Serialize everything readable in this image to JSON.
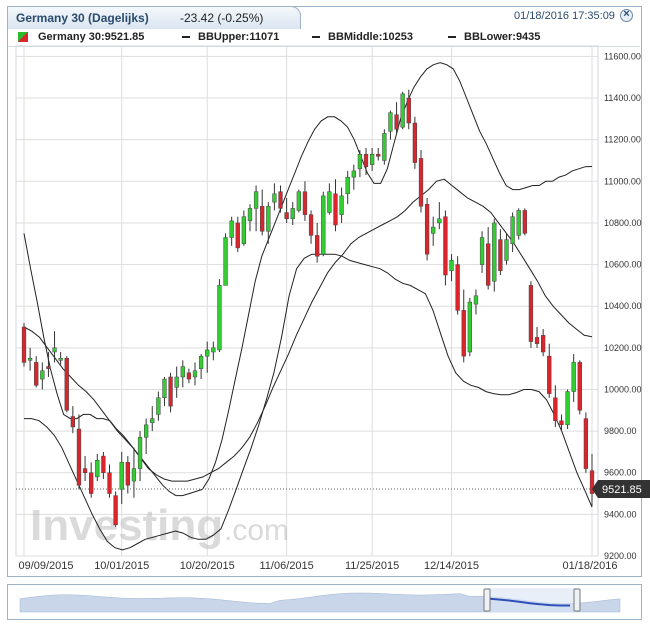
{
  "header": {
    "title": "Germany 30 (Dagelijks)",
    "change": "-23.42 (-0.25%)",
    "datetime": "01/18/2016 17:35:09"
  },
  "legend": {
    "instrument": "Germany 30:9521.85",
    "bb_upper": "BBUpper:11071",
    "bb_middle": "BBMiddle:10253",
    "bb_lower": "BBLower:9435"
  },
  "watermark": "Investing.com",
  "colors": {
    "up": "#33cc33",
    "down": "#d9252b",
    "band": "#222222",
    "grid": "#dddddd",
    "price_tag": "#333333"
  },
  "chart_data": {
    "type": "candlestick",
    "title": "Germany 30 (Dagelijks)",
    "ylim": [
      9200,
      11650
    ],
    "y_ticks": [
      "9200.00",
      "9400.00",
      "9600.00",
      "9800.00",
      "10000.00",
      "10200.00",
      "10400.00",
      "10600.00",
      "10800.00",
      "11000.00",
      "11200.00",
      "11400.00",
      "11600.00"
    ],
    "y_tick_values": [
      9200,
      9400,
      9600,
      9800,
      10000,
      10200,
      10400,
      10600,
      10800,
      11000,
      11200,
      11400,
      11600
    ],
    "x_labels": [
      "09/09/2015",
      "10/01/2015",
      "10/20/2015",
      "11/06/2015",
      "11/25/2015",
      "12/14/2015",
      "01/18/2016"
    ],
    "x_label_index": [
      0,
      16,
      30,
      43,
      57,
      70,
      93
    ],
    "last_price": "9521.85",
    "last_value": 9521.85,
    "candles": [
      [
        10300,
        10320,
        10110,
        10130
      ],
      [
        10140,
        10200,
        10090,
        10150
      ],
      [
        10130,
        10160,
        10010,
        10020
      ],
      [
        10050,
        10130,
        10000,
        10090
      ],
      [
        10110,
        10180,
        10060,
        10100
      ],
      [
        10180,
        10280,
        10130,
        10200
      ],
      [
        10140,
        10180,
        10120,
        10150
      ],
      [
        10150,
        10160,
        9890,
        9900
      ],
      [
        9870,
        9920,
        9790,
        9820
      ],
      [
        9810,
        9880,
        9520,
        9540
      ],
      [
        9620,
        9680,
        9560,
        9600
      ],
      [
        9600,
        9650,
        9480,
        9500
      ],
      [
        9580,
        9690,
        9560,
        9660
      ],
      [
        9680,
        9700,
        9570,
        9600
      ],
      [
        9600,
        9640,
        9480,
        9500
      ],
      [
        9490,
        9510,
        9340,
        9350
      ],
      [
        9520,
        9700,
        9450,
        9650
      ],
      [
        9650,
        9680,
        9500,
        9540
      ],
      [
        9560,
        9720,
        9480,
        9620
      ],
      [
        9620,
        9800,
        9560,
        9770
      ],
      [
        9770,
        9860,
        9690,
        9830
      ],
      [
        9840,
        9920,
        9800,
        9860
      ],
      [
        9880,
        9990,
        9850,
        9960
      ],
      [
        9960,
        10060,
        9920,
        10050
      ],
      [
        10060,
        10080,
        9890,
        9920
      ],
      [
        10010,
        10110,
        9960,
        10060
      ],
      [
        10060,
        10140,
        10010,
        10110
      ],
      [
        10080,
        10100,
        10030,
        10050
      ],
      [
        10060,
        10130,
        10020,
        10090
      ],
      [
        10100,
        10170,
        10050,
        10160
      ],
      [
        10160,
        10230,
        10080,
        10190
      ],
      [
        10180,
        10230,
        10140,
        10200
      ],
      [
        10190,
        10530,
        10180,
        10500
      ],
      [
        10500,
        10750,
        10500,
        10730
      ],
      [
        10730,
        10830,
        10690,
        10810
      ],
      [
        10800,
        10830,
        10660,
        10680
      ],
      [
        10700,
        10860,
        10690,
        10830
      ],
      [
        10810,
        10890,
        10760,
        10870
      ],
      [
        10870,
        10980,
        10760,
        10950
      ],
      [
        10880,
        10960,
        10740,
        10760
      ],
      [
        10760,
        10900,
        10700,
        10880
      ],
      [
        10900,
        10990,
        10860,
        10940
      ],
      [
        10950,
        10980,
        10850,
        10870
      ],
      [
        10850,
        10920,
        10800,
        10820
      ],
      [
        10820,
        10900,
        10790,
        10870
      ],
      [
        10860,
        10960,
        10850,
        10950
      ],
      [
        10950,
        11000,
        10810,
        10840
      ],
      [
        10840,
        10860,
        10700,
        10740
      ],
      [
        10740,
        10800,
        10610,
        10640
      ],
      [
        10650,
        10950,
        10640,
        10930
      ],
      [
        10850,
        10990,
        10840,
        10950
      ],
      [
        10940,
        11010,
        10760,
        10790
      ],
      [
        10840,
        10970,
        10800,
        10930
      ],
      [
        10940,
        11050,
        10890,
        11020
      ],
      [
        11020,
        11080,
        10960,
        11050
      ],
      [
        11060,
        11150,
        11020,
        11130
      ],
      [
        11130,
        11160,
        11030,
        11070
      ],
      [
        11080,
        11160,
        11050,
        11130
      ],
      [
        11130,
        11160,
        11100,
        11120
      ],
      [
        11100,
        11250,
        11080,
        11230
      ],
      [
        11240,
        11340,
        11200,
        11330
      ],
      [
        11320,
        11380,
        11230,
        11250
      ],
      [
        11260,
        11430,
        11250,
        11420
      ],
      [
        11400,
        11440,
        11250,
        11280
      ],
      [
        11280,
        11310,
        11060,
        11090
      ],
      [
        11110,
        11150,
        10850,
        10880
      ],
      [
        10890,
        10920,
        10620,
        10650
      ],
      [
        10750,
        10830,
        10690,
        10780
      ],
      [
        10800,
        10900,
        10770,
        10820
      ],
      [
        10830,
        10860,
        10500,
        10550
      ],
      [
        10570,
        10650,
        10520,
        10620
      ],
      [
        10600,
        10640,
        10360,
        10380
      ],
      [
        10380,
        10480,
        10130,
        10160
      ],
      [
        10180,
        10440,
        10160,
        10420
      ],
      [
        10410,
        10480,
        10360,
        10450
      ],
      [
        10600,
        10760,
        10560,
        10730
      ],
      [
        10700,
        10780,
        10480,
        10500
      ],
      [
        10520,
        10820,
        10470,
        10800
      ],
      [
        10720,
        10770,
        10550,
        10570
      ],
      [
        10620,
        10750,
        10600,
        10720
      ],
      [
        10700,
        10850,
        10660,
        10830
      ],
      [
        10740,
        10870,
        10720,
        10860
      ],
      [
        10860,
        10870,
        10740,
        10750
      ],
      [
        10500,
        10520,
        10200,
        10230
      ],
      [
        10250,
        10300,
        10200,
        10220
      ],
      [
        10260,
        10290,
        10160,
        10180
      ],
      [
        10160,
        10220,
        9960,
        9980
      ],
      [
        9960,
        10020,
        9820,
        9850
      ],
      [
        9850,
        9880,
        9800,
        9830
      ],
      [
        9830,
        10000,
        9810,
        9990
      ],
      [
        9990,
        10170,
        9940,
        10130
      ],
      [
        10130,
        10140,
        9880,
        9900
      ],
      [
        9860,
        9890,
        9600,
        9620
      ],
      [
        9610,
        9690,
        9440,
        9500
      ]
    ],
    "bb_upper": [
      10750,
      10580,
      10420,
      10250,
      10100,
      9980,
      9880,
      9860,
      9860,
      9880,
      9880,
      9860,
      9860,
      9850,
      9810,
      9780,
      9740,
      9700,
      9660,
      9620,
      9580,
      9540,
      9510,
      9490,
      9490,
      9500,
      9510,
      9520,
      9570,
      9650,
      9760,
      9900,
      10050,
      10200,
      10360,
      10520,
      10640,
      10720,
      10800,
      10880,
      10960,
      11040,
      11120,
      11190,
      11250,
      11290,
      11310,
      11310,
      11290,
      11260,
      11200,
      11120,
      11040,
      10990,
      10990,
      11060,
      11180,
      11300,
      11380,
      11450,
      11500,
      11540,
      11560,
      11570,
      11560,
      11540,
      11480,
      11400,
      11320,
      11240,
      11180,
      11110,
      11040,
      10980,
      10960,
      10960,
      10970,
      10980,
      10980,
      11000,
      11000,
      11020,
      11030,
      11050,
      11060,
      11070,
      11071
    ],
    "bb_middle": [
      10300,
      10280,
      10250,
      10200,
      10150,
      10100,
      10060,
      10020,
      9990,
      9950,
      9900,
      9850,
      9800,
      9760,
      9720,
      9670,
      9620,
      9590,
      9570,
      9560,
      9560,
      9560,
      9570,
      9580,
      9600,
      9620,
      9650,
      9680,
      9720,
      9770,
      9840,
      9920,
      10010,
      10090,
      10170,
      10260,
      10340,
      10420,
      10490,
      10560,
      10610,
      10650,
      10700,
      10730,
      10750,
      10770,
      10790,
      10810,
      10830,
      10860,
      10900,
      10930,
      10960,
      11000,
      11010,
      10980,
      10950,
      10920,
      10900,
      10880,
      10850,
      10800,
      10750,
      10700,
      10640,
      10580,
      10520,
      10450,
      10400,
      10360,
      10320,
      10290,
      10260,
      10253
    ],
    "bb_lower": [
      9860,
      9860,
      9850,
      9820,
      9780,
      9720,
      9640,
      9560,
      9480,
      9400,
      9330,
      9270,
      9240,
      9230,
      9240,
      9260,
      9280,
      9290,
      9300,
      9310,
      9320,
      9310,
      9290,
      9280,
      9280,
      9300,
      9330,
      9420,
      9520,
      9620,
      9720,
      9830,
      9950,
      10080,
      10250,
      10450,
      10580,
      10630,
      10650,
      10650,
      10650,
      10650,
      10640,
      10620,
      10610,
      10600,
      10590,
      10580,
      10560,
      10530,
      10510,
      10500,
      10480,
      10460,
      10380,
      10270,
      10160,
      10080,
      10040,
      10020,
      10010,
      9990,
      9980,
      9975,
      9975,
      9985,
      10000,
      10000,
      9990,
      9950,
      9880,
      9800,
      9700,
      9600,
      9520,
      9435
    ]
  }
}
